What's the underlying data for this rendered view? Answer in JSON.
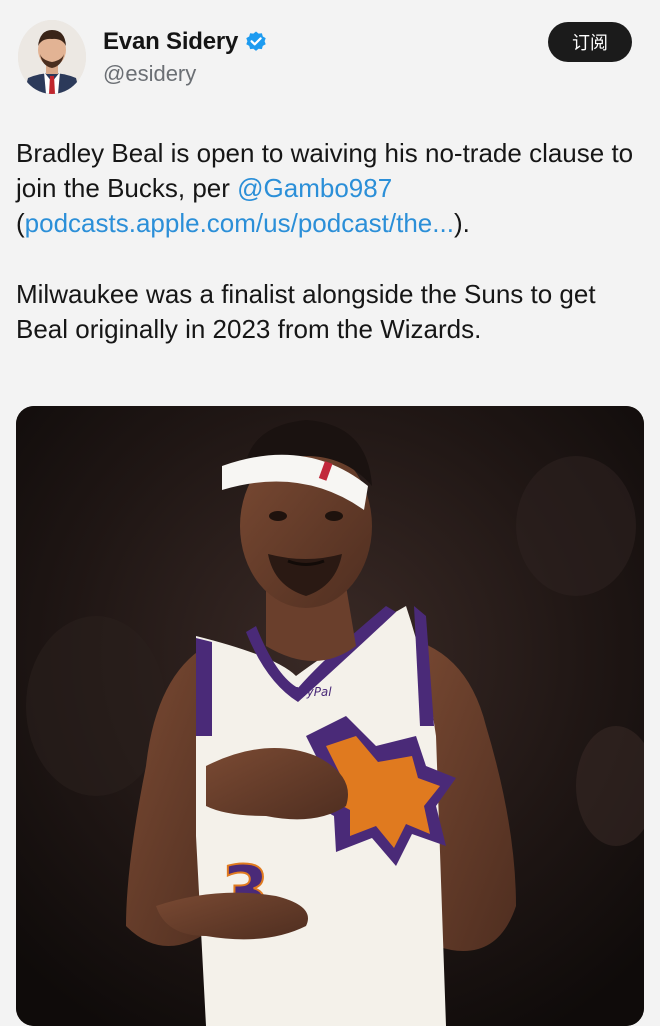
{
  "author": {
    "display_name": "Evan Sidery",
    "handle": "@esidery",
    "verified": true,
    "avatar_icon": "profile-photo"
  },
  "subscribe_button": {
    "label": "订阅"
  },
  "tweet": {
    "para1_text_a": "Bradley Beal is open to waiving his no-trade clause to join the Bucks, per ",
    "para1_mention": "@Gambo987",
    "para1_open_paren": "(",
    "para1_link": "podcasts.apple.com/us/podcast/the...",
    "para1_close": ").",
    "para2": "Milwaukee was a finalist alongside the Suns to get Beal originally in 2023 from the Wizards."
  },
  "media": {
    "jersey_number_fragment": "3",
    "jersey_sponsor": "PayPal",
    "colors": {
      "jersey": "#f4f1ea",
      "purple": "#4a2a78",
      "orange": "#e07a1f"
    }
  },
  "colors": {
    "link": "#2b8fd8",
    "verified": "#1d9bf0",
    "button_bg": "#1b1b1b"
  }
}
